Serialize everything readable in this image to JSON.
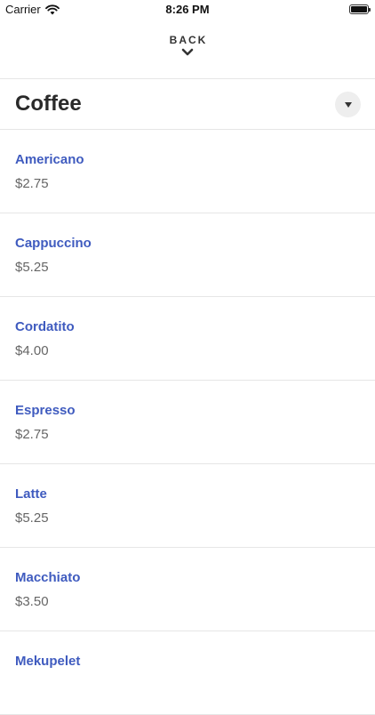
{
  "status_bar": {
    "carrier": "Carrier",
    "time": "8:26 PM",
    "wifi_icon": "wifi-icon",
    "battery_icon": "battery-icon"
  },
  "nav": {
    "back_label": "BACK",
    "back_icon": "chevron-down-icon"
  },
  "section": {
    "title": "Coffee",
    "dropdown_icon": "caret-down-icon"
  },
  "colors": {
    "item_name": "#3f5bbf",
    "item_price": "#666666",
    "divider": "#e6e6e6"
  },
  "items": [
    {
      "name": "Americano",
      "price": "$2.75"
    },
    {
      "name": "Cappuccino",
      "price": "$5.25"
    },
    {
      "name": "Cordatito",
      "price": "$4.00"
    },
    {
      "name": "Espresso",
      "price": "$2.75"
    },
    {
      "name": "Latte",
      "price": "$5.25"
    },
    {
      "name": "Macchiato",
      "price": "$3.50"
    },
    {
      "name": "Mekupelet",
      "price": ""
    }
  ]
}
